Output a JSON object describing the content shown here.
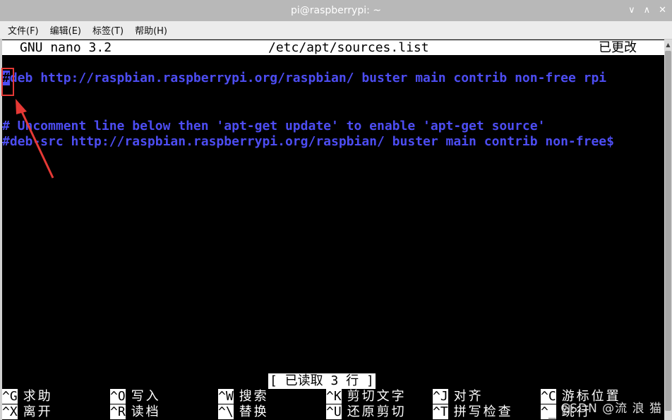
{
  "window": {
    "title": "pi@raspberrypi: ~",
    "controls": [
      "∨",
      "∧",
      "✕"
    ]
  },
  "menubar": {
    "items": [
      "文件(F)",
      "编辑(E)",
      "标签(T)",
      "帮助(H)"
    ]
  },
  "nano": {
    "version": "GNU nano 3.2",
    "filename": "/etc/apt/sources.list",
    "modified": "已更改",
    "line1_cursor": "#",
    "line1_rest": "deb http://raspbian.raspberrypi.org/raspbian/ buster main contrib non-free rpi",
    "line2": "# Uncomment line below then 'apt-get update' to enable 'apt-get source'",
    "line3": "#deb-src http://raspbian.raspberrypi.org/raspbian/ buster main contrib non-free$",
    "status": "[ 已读取 3 行 ]"
  },
  "shortcuts": {
    "row1": [
      {
        "key": "^G",
        "label": "求助"
      },
      {
        "key": "^O",
        "label": "写入"
      },
      {
        "key": "^W",
        "label": "搜索"
      },
      {
        "key": "^K",
        "label": "剪切文字"
      },
      {
        "key": "^J",
        "label": "对齐"
      },
      {
        "key": "^C",
        "label": "游标位置"
      }
    ],
    "row2": [
      {
        "key": "^X",
        "label": "离开"
      },
      {
        "key": "^R",
        "label": "读档"
      },
      {
        "key": "^\\",
        "label": "替换"
      },
      {
        "key": "^U",
        "label": "还原剪切"
      },
      {
        "key": "^T",
        "label": "拼写检查"
      },
      {
        "key": "^_",
        "label": "跳行"
      }
    ]
  },
  "watermark": "CSDN @流 浪 猫",
  "colors": {
    "terminal_bg": "#000000",
    "text_blue": "#4d4df2",
    "annotation_red": "#e53935"
  }
}
